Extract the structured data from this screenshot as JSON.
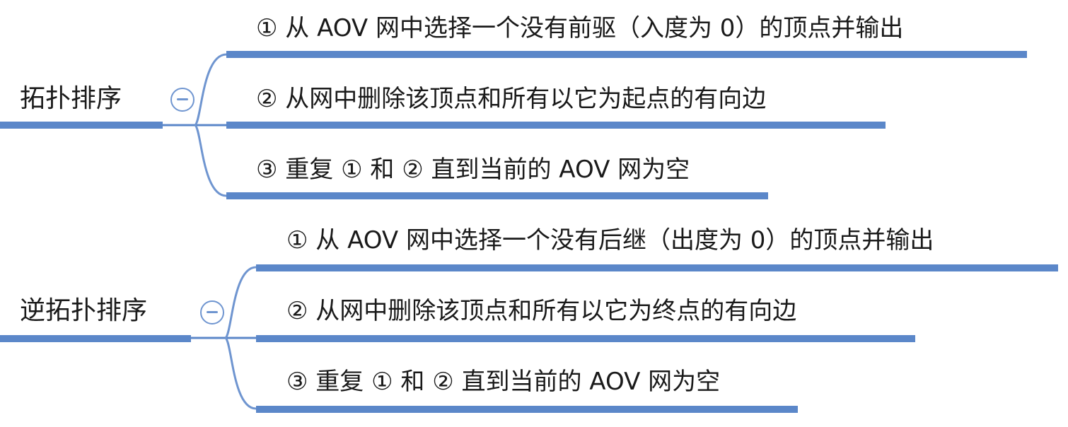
{
  "mindmap": [
    {
      "title": "拓扑排序",
      "children": [
        "① 从 AOV 网中选择一个没有前驱（入度为 0）的顶点并输出",
        "② 从网中删除该顶点和所有以它为起点的有向边",
        "③ 重复 ① 和 ② 直到当前的 AOV 网为空"
      ]
    },
    {
      "title": "逆拓扑排序",
      "children": [
        "① 从 AOV 网中选择一个没有后继（出度为 0）的顶点并输出",
        "② 从网中删除该顶点和所有以它为终点的有向边",
        "③ 重复 ① 和 ② 直到当前的 AOV 网为空"
      ]
    }
  ],
  "colors": {
    "line": "#5b87c9",
    "toggle": "#6f95d0",
    "text": "#1a1a1a"
  },
  "icons": {
    "collapse": "collapse-minus-icon"
  }
}
